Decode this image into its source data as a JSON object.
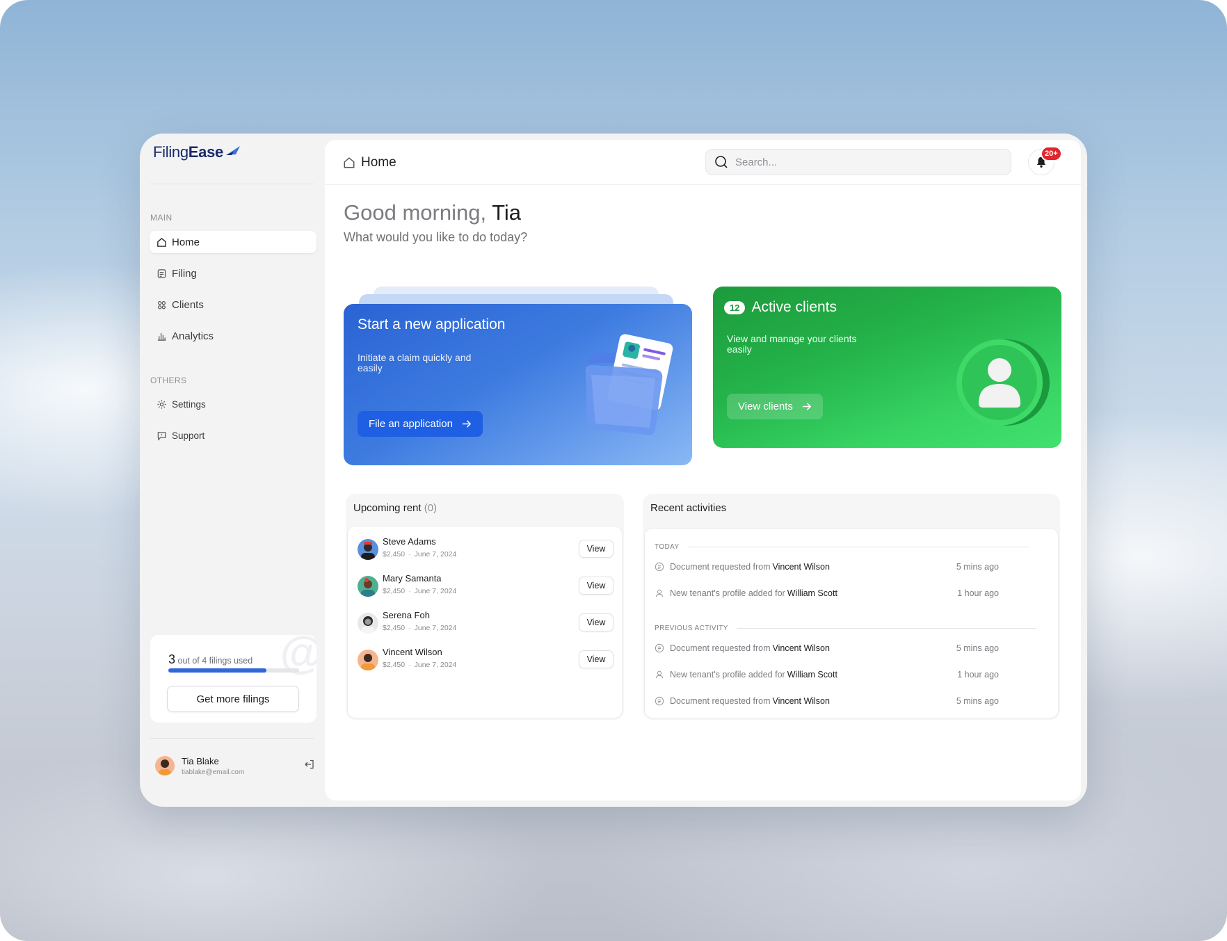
{
  "app": {
    "logo": {
      "part1": "Filing",
      "part2": "Ease"
    },
    "brand_color": "#1b2a6b",
    "accent": "#2f66d8"
  },
  "sidebar": {
    "main_label": "MAIN",
    "main_items": [
      {
        "label": "Home",
        "icon": "home-icon",
        "active": true
      },
      {
        "label": "Filing",
        "icon": "file-icon"
      },
      {
        "label": "Clients",
        "icon": "users-icon"
      },
      {
        "label": "Analytics",
        "icon": "chart-icon"
      }
    ],
    "others_label": "OTHERS",
    "other_items": [
      {
        "label": "Settings",
        "icon": "gear-icon"
      },
      {
        "label": "Support",
        "icon": "chat-icon"
      }
    ],
    "usage": {
      "used": "3",
      "text": "out of 4 filings used",
      "fraction": 0.75,
      "button": "Get more filings"
    },
    "user": {
      "name": "Tia Blake",
      "email": "tiablake@email.com"
    }
  },
  "header": {
    "crumb": "Home",
    "search_placeholder": "Search...",
    "notifications": "20+"
  },
  "greeting": {
    "prefix": "Good morning,",
    "name": "Tia",
    "subtitle": "What would you like to do today?"
  },
  "cards": {
    "application": {
      "title": "Start a new application",
      "desc": "Initiate a claim quickly and easily",
      "button": "File an application"
    },
    "clients": {
      "count": "12",
      "title": "Active clients",
      "desc": "View and manage your clients easily",
      "button": "View clients"
    }
  },
  "rent": {
    "title": "Upcoming rent",
    "count": "(0)",
    "view_label": "View",
    "rows": [
      {
        "name": "Steve Adams",
        "amount": "$2,450",
        "date": "June 7, 2024"
      },
      {
        "name": "Mary Samanta",
        "amount": "$2,450",
        "date": "June 7, 2024"
      },
      {
        "name": "Serena Foh",
        "amount": "$2,450",
        "date": "June 7, 2024"
      },
      {
        "name": "Vincent Wilson",
        "amount": "$2,450",
        "date": "June 7, 2024"
      }
    ]
  },
  "activities": {
    "title": "Recent activities",
    "today_label": "TODAY",
    "previous_label": "PREVIOUS ACTIVITY",
    "today": [
      {
        "text": "Document requested from",
        "who": "Vincent Wilson",
        "time": "5 mins ago",
        "icon": "document-icon"
      },
      {
        "text": "New tenant's profile added for",
        "who": "William Scott",
        "time": "1 hour ago",
        "icon": "user-icon"
      }
    ],
    "previous": [
      {
        "text": "Document requested from",
        "who": "Vincent Wilson",
        "time": "5 mins ago",
        "icon": "document-icon"
      },
      {
        "text": "New tenant's profile added for",
        "who": "William Scott",
        "time": "1 hour ago",
        "icon": "user-icon"
      },
      {
        "text": "Document requested from",
        "who": "Vincent Wilson",
        "time": "5 mins ago",
        "icon": "document-icon"
      }
    ]
  }
}
